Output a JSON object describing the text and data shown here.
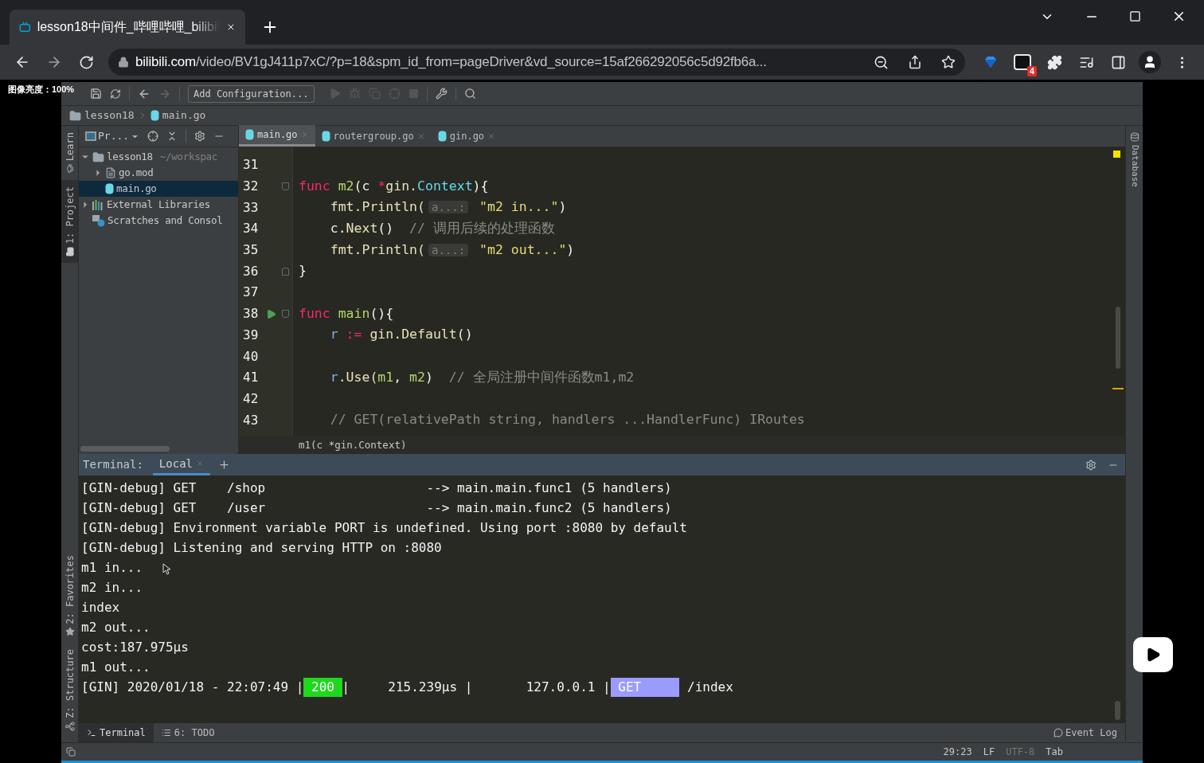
{
  "browser": {
    "tab_title": "lesson18中间件_哔哩哔哩_bilibil",
    "url_domain": "bilibili.com",
    "url_path": "/video/BV1gJ411p7xC/?p=18&spm_id_from=pageDriver&vd_source=15af266292056c5d92fb6a...",
    "extension_badge": "4"
  },
  "overlay_label": "图像亮度：100%",
  "ide": {
    "run_configuration": "Add Configuration...",
    "breadcrumb": [
      {
        "label": "lesson18",
        "kind": "folder"
      },
      {
        "label": "main.go",
        "kind": "go"
      }
    ],
    "left_tools_top": [
      {
        "label": "Learn",
        "kind": "learn"
      },
      {
        "label": "1: Project",
        "kind": "folder"
      }
    ],
    "left_tools_bottom": [
      {
        "label": "2: Favorites",
        "kind": "star"
      },
      {
        "label": "Z: Structure",
        "kind": "structure"
      }
    ],
    "right_tools": [
      {
        "label": "Database",
        "kind": "database"
      }
    ],
    "project": {
      "title": "Pr...",
      "tree": [
        {
          "label": "lesson18",
          "hint": "~/workspac",
          "kind": "folder",
          "expanded": true,
          "selected": false,
          "children": [
            {
              "label": "go.mod",
              "kind": "file",
              "expanded": false,
              "selected": false
            },
            {
              "label": "main.go",
              "kind": "go",
              "selected": true
            }
          ]
        },
        {
          "label": "External Libraries",
          "kind": "library",
          "expanded": false,
          "selected": false
        },
        {
          "label": "Scratches and Consol",
          "kind": "scratch",
          "selected": false
        }
      ]
    },
    "editor": {
      "tabs": [
        {
          "label": "main.go",
          "selected": true
        },
        {
          "label": "routergroup.go",
          "selected": false
        },
        {
          "label": "gin.go",
          "selected": false
        }
      ],
      "lines": [
        {
          "number": "31",
          "kind": "plain"
        },
        {
          "number": "32",
          "kind": "fold-start",
          "tokens": [
            {
              "text": "func ",
              "kind": "kw"
            },
            {
              "text": "m2",
              "kind": "fn"
            },
            {
              "text": "(c ",
              "kind": "plain"
            },
            {
              "text": "*",
              "kind": "kw"
            },
            {
              "text": "gin.",
              "kind": "ident"
            },
            {
              "text": "Context",
              "kind": "type"
            },
            {
              "text": "){",
              "kind": "plain"
            }
          ]
        },
        {
          "number": "33",
          "kind": "plain",
          "tokens": [
            {
              "text": "    fmt.Println(",
              "kind": "ident"
            },
            {
              "text": "a...:",
              "kind": "hint"
            },
            {
              "text": " \"m2 in...\"",
              "kind": "str"
            },
            {
              "text": ")",
              "kind": "plain"
            }
          ]
        },
        {
          "number": "34",
          "kind": "plain",
          "tokens": [
            {
              "text": "    c.",
              "kind": "plain"
            },
            {
              "text": "Next",
              "kind": "ident"
            },
            {
              "text": "()  ",
              "kind": "plain"
            },
            {
              "text": "// 调用后续的处理函数",
              "kind": "comment"
            }
          ]
        },
        {
          "number": "35",
          "kind": "plain",
          "tokens": [
            {
              "text": "    fmt.Println(",
              "kind": "ident"
            },
            {
              "text": "a...:",
              "kind": "hint"
            },
            {
              "text": " \"m2 out...\"",
              "kind": "str"
            },
            {
              "text": ")",
              "kind": "plain"
            }
          ]
        },
        {
          "number": "36",
          "kind": "fold-end",
          "tokens": [
            {
              "text": "}",
              "kind": "plain"
            }
          ]
        },
        {
          "number": "37",
          "kind": "plain"
        },
        {
          "number": "38",
          "run": true,
          "kind": "fold-start",
          "tokens": [
            {
              "text": "func ",
              "kind": "kw"
            },
            {
              "text": "main",
              "kind": "fn"
            },
            {
              "text": "(){",
              "kind": "plain"
            }
          ]
        },
        {
          "number": "39",
          "kind": "plain",
          "tokens": [
            {
              "text": "    r ",
              "kind": "var"
            },
            {
              "text": ":= ",
              "kind": "kw"
            },
            {
              "text": "gin.Default",
              "kind": "ident"
            },
            {
              "text": "()",
              "kind": "plain"
            }
          ]
        },
        {
          "number": "40",
          "kind": "plain"
        },
        {
          "number": "41",
          "kind": "plain",
          "tokens": [
            {
              "text": "    r",
              "kind": "var"
            },
            {
              "text": ".Use(",
              "kind": "ident"
            },
            {
              "text": "m1",
              "kind": "fn"
            },
            {
              "text": ", ",
              "kind": "plain"
            },
            {
              "text": "m2",
              "kind": "fn"
            },
            {
              "text": ")  ",
              "kind": "plain"
            },
            {
              "text": "// 全局注册中间件函数m1,m2",
              "kind": "comment"
            }
          ]
        },
        {
          "number": "42",
          "kind": "plain"
        },
        {
          "number": "43",
          "kind": "plain",
          "tokens": [
            {
              "text": "    // GET(relativePath string, handlers ...HandlerFunc) IRoutes",
              "kind": "comment"
            }
          ]
        }
      ],
      "context": "m1(c *gin.Context)"
    },
    "terminal": {
      "title": "Terminal:",
      "tabs": [
        {
          "label": "Local",
          "selected": true
        }
      ],
      "lines": [
        {
          "kind": "text",
          "text": "[GIN-debug] GET    /shop                     --> main.main.func1 (5 handlers)"
        },
        {
          "kind": "text",
          "text": "[GIN-debug] GET    /user                     --> main.main.func2 (5 handlers)"
        },
        {
          "kind": "text",
          "text": "[GIN-debug] Environment variable PORT is undefined. Using port :8080 by default"
        },
        {
          "kind": "text",
          "text": "[GIN-debug] Listening and serving HTTP on :8080"
        },
        {
          "kind": "text",
          "text": "m1 in..."
        },
        {
          "kind": "text",
          "text": "m2 in..."
        },
        {
          "kind": "text",
          "text": "index"
        },
        {
          "kind": "text",
          "text": "m2 out..."
        },
        {
          "kind": "text",
          "text": "cost:187.975µs"
        },
        {
          "kind": "text",
          "text": "m1 out..."
        },
        {
          "kind": "request",
          "segments": [
            {
              "kind": "text",
              "text": "[GIN] 2020/01/18 - 22:07:49 |"
            },
            {
              "kind": "badge",
              "text": " 200 ",
              "color": "#1ed81e"
            },
            {
              "kind": "text",
              "text": "|     215.239µs |       127.0.0.1 |"
            },
            {
              "kind": "badge",
              "text": " GET     ",
              "color": "#9b9bff"
            },
            {
              "kind": "text",
              "text": " /index"
            }
          ]
        }
      ]
    },
    "bottom_tools": [
      {
        "label": "Terminal",
        "kind": "terminal",
        "selected": true
      },
      {
        "label": "6: TODO",
        "kind": "todo",
        "selected": false
      }
    ],
    "event_log": "Event Log",
    "status": [
      {
        "text": "29:23",
        "disabled": false
      },
      {
        "text": "LF",
        "disabled": false
      },
      {
        "text": "UTF-8",
        "disabled": true
      },
      {
        "text": "Tab",
        "disabled": false
      }
    ]
  }
}
